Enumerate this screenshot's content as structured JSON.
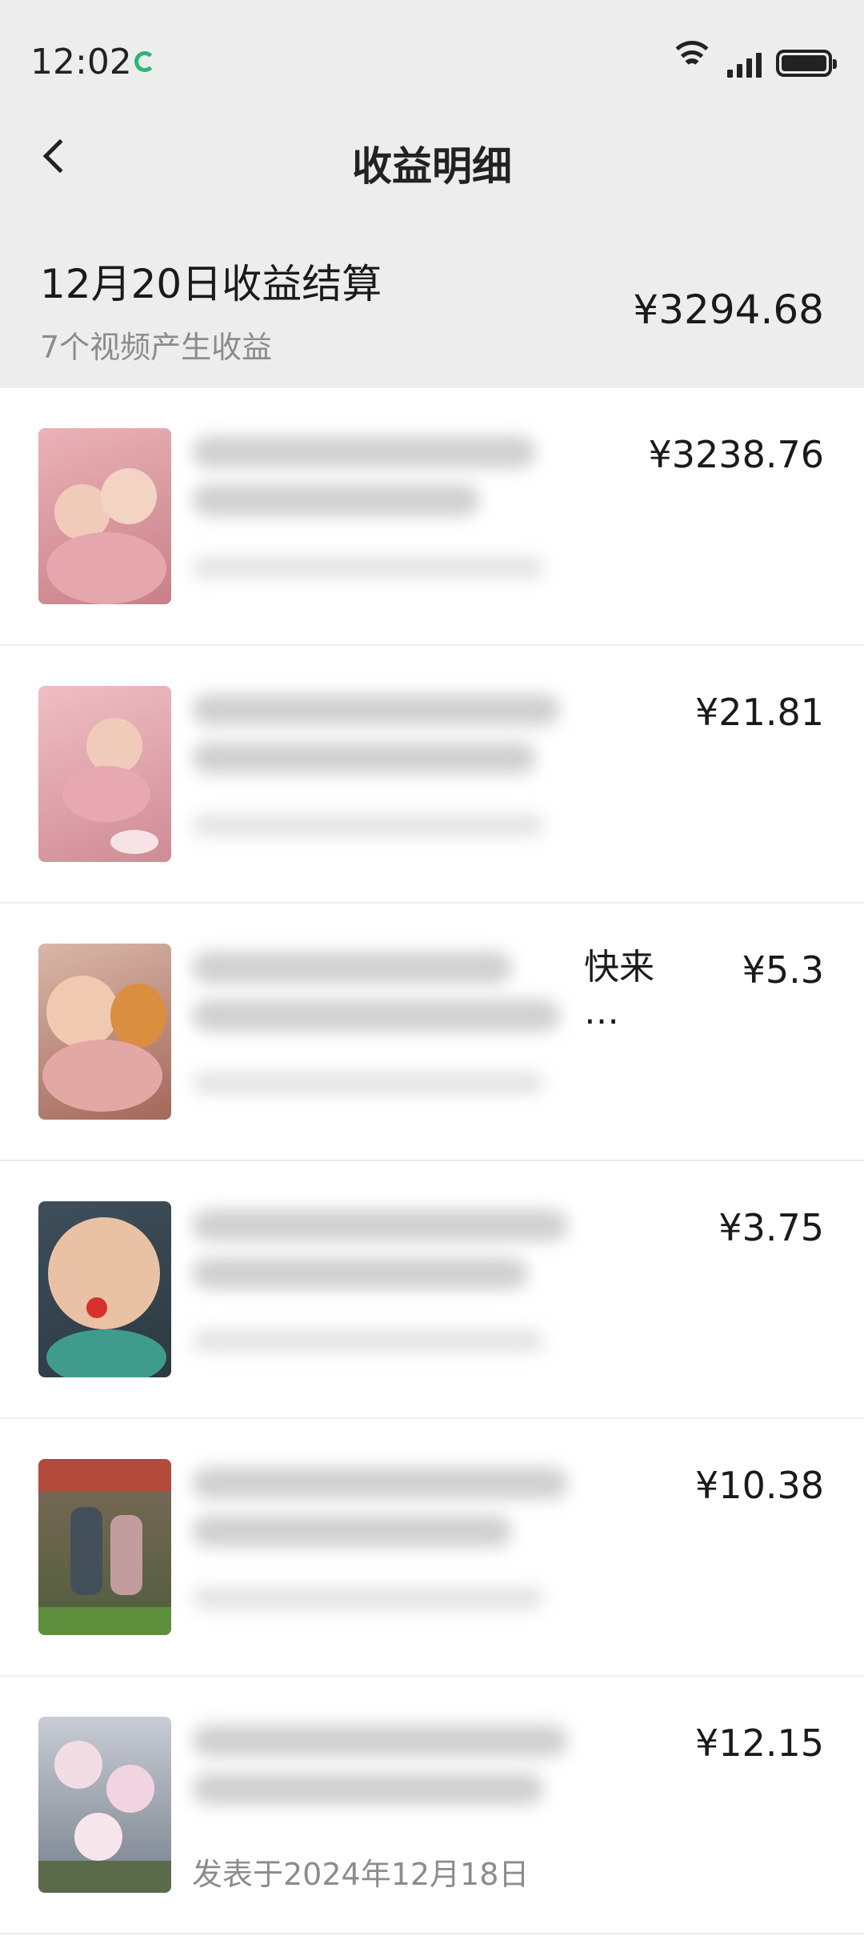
{
  "status": {
    "time": "12:02",
    "network": "6"
  },
  "nav": {
    "title": "收益明细"
  },
  "summary": {
    "title": "12月20日收益结算",
    "subtitle": "7个视频产生收益",
    "amount": "¥3294.68"
  },
  "items": [
    {
      "amount": "¥3238.76",
      "peek1": "",
      "peek2": "",
      "date": ""
    },
    {
      "amount": "¥21.81",
      "peek1": "",
      "peek2": "",
      "date": ""
    },
    {
      "amount": "¥5.3",
      "peek1": "快来",
      "peek2": "…",
      "date": ""
    },
    {
      "amount": "¥3.75",
      "peek1": "",
      "peek2": "",
      "date": ""
    },
    {
      "amount": "¥10.38",
      "peek1": "",
      "peek2": "",
      "date": ""
    },
    {
      "amount": "¥12.15",
      "peek1": "",
      "peek2": "",
      "date": "发表于2024年12月18日"
    }
  ],
  "colors": {
    "header_bg": "#ededed",
    "secondary_text": "#8c8c8c",
    "sync_icon": "#2bb673"
  }
}
